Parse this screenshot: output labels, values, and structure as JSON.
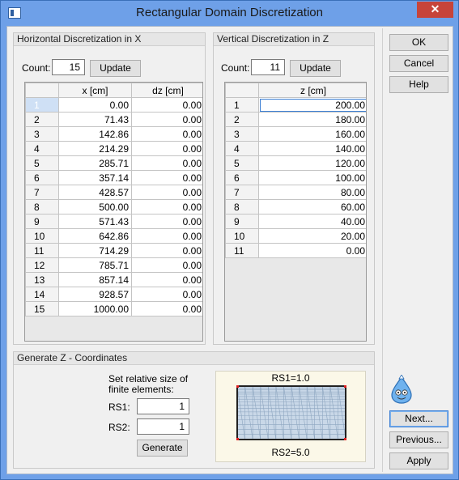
{
  "window": {
    "title": "Rectangular Domain Discretization",
    "close_label": "✕"
  },
  "horizontal": {
    "header": "Horizontal Discretization in X",
    "count_label": "Count:",
    "count_value": "15",
    "update_label": "Update",
    "columns": [
      "x [cm]",
      "dz [cm]"
    ],
    "rows": [
      {
        "n": "1",
        "x": "0.00",
        "dz": "0.00"
      },
      {
        "n": "2",
        "x": "71.43",
        "dz": "0.00"
      },
      {
        "n": "3",
        "x": "142.86",
        "dz": "0.00"
      },
      {
        "n": "4",
        "x": "214.29",
        "dz": "0.00"
      },
      {
        "n": "5",
        "x": "285.71",
        "dz": "0.00"
      },
      {
        "n": "6",
        "x": "357.14",
        "dz": "0.00"
      },
      {
        "n": "7",
        "x": "428.57",
        "dz": "0.00"
      },
      {
        "n": "8",
        "x": "500.00",
        "dz": "0.00"
      },
      {
        "n": "9",
        "x": "571.43",
        "dz": "0.00"
      },
      {
        "n": "10",
        "x": "642.86",
        "dz": "0.00"
      },
      {
        "n": "11",
        "x": "714.29",
        "dz": "0.00"
      },
      {
        "n": "12",
        "x": "785.71",
        "dz": "0.00"
      },
      {
        "n": "13",
        "x": "857.14",
        "dz": "0.00"
      },
      {
        "n": "14",
        "x": "928.57",
        "dz": "0.00"
      },
      {
        "n": "15",
        "x": "1000.00",
        "dz": "0.00"
      }
    ]
  },
  "vertical": {
    "header": "Vertical Discretization in Z",
    "count_label": "Count:",
    "count_value": "11",
    "update_label": "Update",
    "columns": [
      "z [cm]"
    ],
    "rows": [
      {
        "n": "1",
        "z": "200.00"
      },
      {
        "n": "2",
        "z": "180.00"
      },
      {
        "n": "3",
        "z": "160.00"
      },
      {
        "n": "4",
        "z": "140.00"
      },
      {
        "n": "5",
        "z": "120.00"
      },
      {
        "n": "6",
        "z": "100.00"
      },
      {
        "n": "7",
        "z": "80.00"
      },
      {
        "n": "8",
        "z": "60.00"
      },
      {
        "n": "9",
        "z": "40.00"
      },
      {
        "n": "10",
        "z": "20.00"
      },
      {
        "n": "11",
        "z": "0.00"
      }
    ]
  },
  "generate": {
    "header": "Generate Z - Coordinates",
    "instruction_line1": "Set relative size of",
    "instruction_line2": "finite elements:",
    "rs1_label": "RS1:",
    "rs1_value": "1",
    "rs2_label": "RS2:",
    "rs2_value": "1",
    "generate_label": "Generate",
    "preview_top": "RS1=1.0",
    "preview_bottom": "RS2=5.0"
  },
  "buttons": {
    "ok": "OK",
    "cancel": "Cancel",
    "help": "Help",
    "next": "Next...",
    "previous": "Previous...",
    "apply": "Apply"
  },
  "icons": {
    "app": "app-window-icon",
    "close": "close-icon",
    "mascot": "assistant-mascot-icon"
  },
  "colors": {
    "titlebar": "#6ea0e8",
    "close": "#c7443a",
    "selection": "#3c7fd4"
  }
}
